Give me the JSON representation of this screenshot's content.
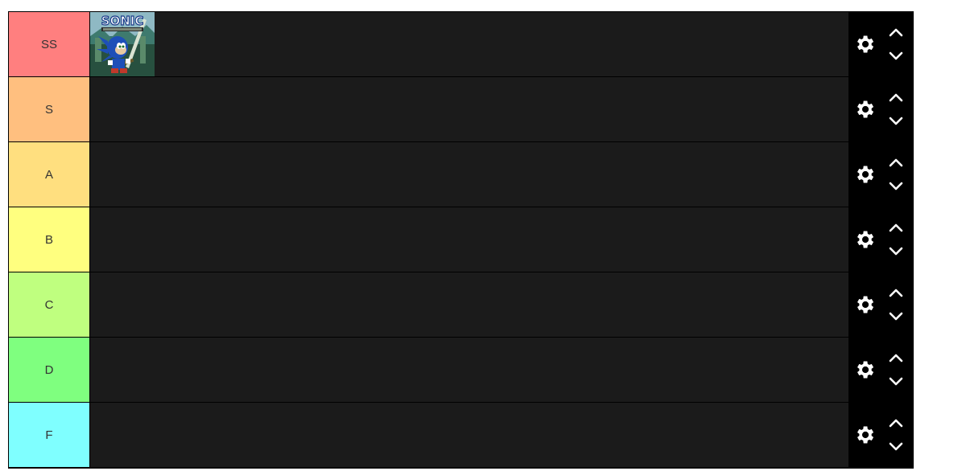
{
  "tiers": [
    {
      "label": "SS",
      "color": "#ff7f7f"
    },
    {
      "label": "S",
      "color": "#ffbf7f"
    },
    {
      "label": "A",
      "color": "#ffdf7f"
    },
    {
      "label": "B",
      "color": "#ffff7f"
    },
    {
      "label": "C",
      "color": "#bfff7f"
    },
    {
      "label": "D",
      "color": "#7fff7f"
    },
    {
      "label": "F",
      "color": "#7fffff"
    }
  ],
  "ss_item": {
    "icon": "sonic-black-knight-cover",
    "logo_text": "SONIC"
  },
  "icons": {
    "settings": "gear-icon",
    "up": "chevron-up-icon",
    "down": "chevron-down-icon"
  }
}
